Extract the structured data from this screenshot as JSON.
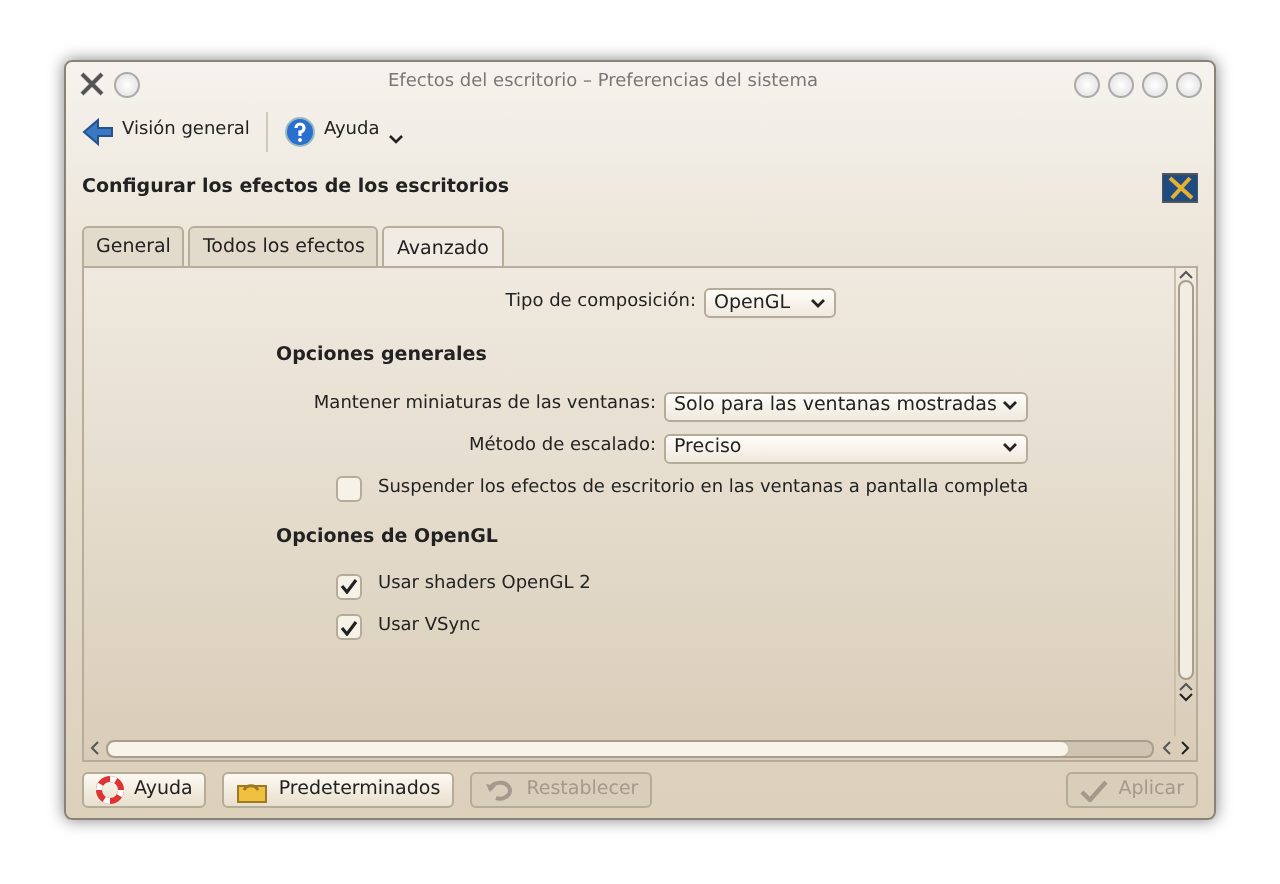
{
  "window": {
    "title": "Efectos del escritorio – Preferencias del sistema"
  },
  "toolbar": [
    {
      "kind": "back",
      "label": "Visión general"
    },
    {
      "kind": "help",
      "label": "Ayuda"
    }
  ],
  "heading": "Configurar los efectos de los escritorios",
  "tabs": [
    {
      "label": "General",
      "selected": false
    },
    {
      "label": "Todos los efectos",
      "selected": false
    },
    {
      "label": "Avanzado",
      "selected": true
    }
  ],
  "composition": {
    "label": "Tipo de composición:",
    "value": "OpenGL"
  },
  "sections": [
    {
      "title": "Opciones generales",
      "items": [
        {
          "kind": "select",
          "label": "Mantener miniaturas de las ventanas:",
          "value": "Solo para las ventanas mostradas"
        },
        {
          "kind": "select",
          "label": "Método de escalado:",
          "value": "Preciso"
        },
        {
          "kind": "checkbox",
          "label": "Suspender los efectos de escritorio en las ventanas a pantalla completa",
          "checked": false
        }
      ]
    },
    {
      "title": "Opciones de OpenGL",
      "items": [
        {
          "kind": "checkbox",
          "label": "Usar shaders OpenGL 2",
          "checked": true
        },
        {
          "kind": "checkbox",
          "label": "Usar VSync",
          "checked": true
        }
      ]
    }
  ],
  "buttons": [
    {
      "kind": "help",
      "label": "Ayuda",
      "disabled": false
    },
    {
      "kind": "defaults",
      "label": "Predeterminados",
      "disabled": false
    },
    {
      "kind": "reset",
      "label": "Restablecer",
      "disabled": true
    },
    {
      "kind": "apply",
      "label": "Aplicar",
      "disabled": true
    }
  ]
}
